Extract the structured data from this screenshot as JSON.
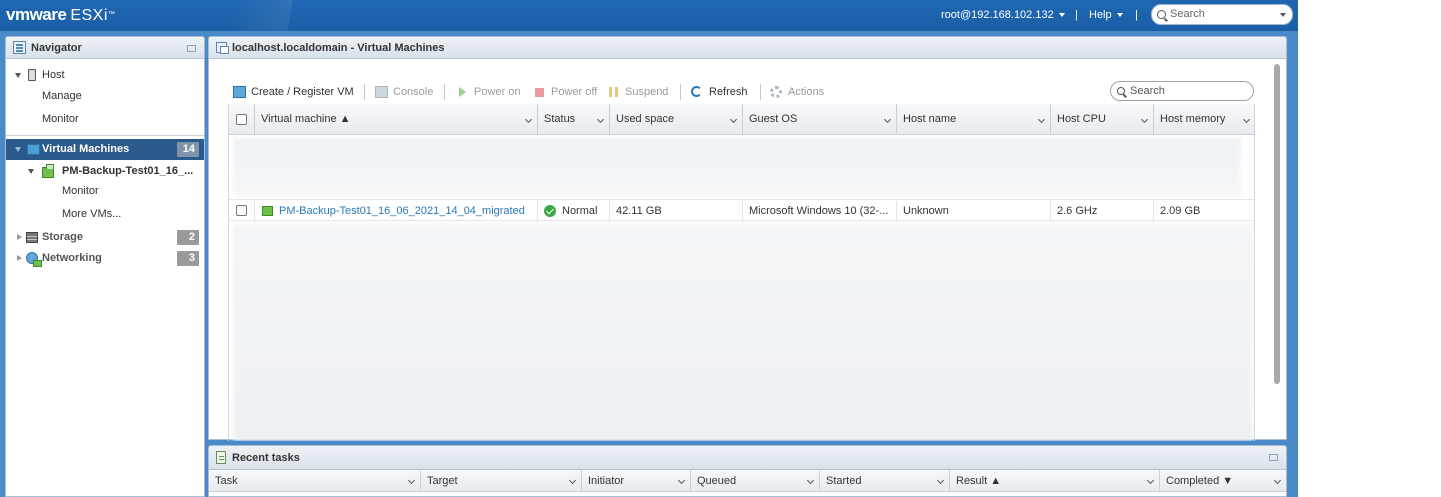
{
  "header": {
    "logo_vm": "vmware",
    "logo_product": "ESXi",
    "logo_tm": "™",
    "user": "root@192.168.102.132",
    "help": "Help",
    "separator": "|",
    "search_placeholder": "Search"
  },
  "navigator": {
    "title": "Navigator",
    "items": [
      {
        "label": "Host"
      },
      {
        "label": "Manage"
      },
      {
        "label": "Monitor"
      },
      {
        "label": "Virtual Machines",
        "count": "14"
      },
      {
        "label": "PM-Backup-Test01_16_..."
      },
      {
        "label": "Monitor"
      },
      {
        "label": "More VMs..."
      },
      {
        "label": "Storage",
        "count": "2"
      },
      {
        "label": "Networking",
        "count": "3"
      }
    ]
  },
  "main": {
    "title": "localhost.localdomain - Virtual Machines",
    "toolbar": {
      "create": "Create / Register VM",
      "console": "Console",
      "power_on": "Power on",
      "power_off": "Power off",
      "suspend": "Suspend",
      "refresh": "Refresh",
      "actions": "Actions"
    },
    "search_placeholder": "Search",
    "columns": [
      "Virtual machine ▲",
      "Status",
      "Used space",
      "Guest OS",
      "Host name",
      "Host CPU",
      "Host memory"
    ],
    "vm_row": {
      "name": "PM-Backup-Test01_16_06_2021_14_04_migrated",
      "status": "Normal",
      "used_space": "42.11 GB",
      "guest_os": "Microsoft Windows 10 (32-...",
      "host_name": "Unknown",
      "host_cpu": "2.6 GHz",
      "host_memory": "2.09 GB"
    }
  },
  "tasks": {
    "title": "Recent tasks",
    "columns": [
      "Task",
      "Target",
      "Initiator",
      "Queued",
      "Started",
      "Result ▲",
      "Completed ▼"
    ]
  },
  "colors": {
    "header_blue": "#1f67b3",
    "selected_nav": "#2b5b8c",
    "link_blue": "#2a78b8",
    "ok_green": "#3aa845"
  }
}
